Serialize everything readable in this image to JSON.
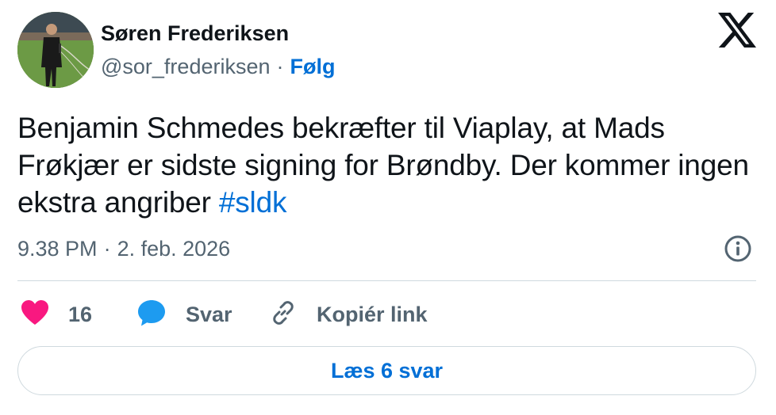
{
  "author": {
    "name": "Søren Frederiksen",
    "handle": "@sor_frederiksen",
    "separator": "·",
    "follow_label": "Følg"
  },
  "tweet": {
    "text": "Benjamin Schmedes bekræfter til Viaplay, at Mads Frøkjær er sidste signing for Brøndby. Der kommer ingen ekstra angriber ",
    "hashtag": "#sldk",
    "time": "9.38 PM",
    "time_separator": "·",
    "date": "2. feb. 2026"
  },
  "actions": {
    "like_count": "16",
    "reply_label": "Svar",
    "copy_link_label": "Kopiér link"
  },
  "read_replies_label": "Læs 6 svar",
  "icons": {
    "like": "heart-icon",
    "reply": "speech-bubble-icon",
    "copy": "link-icon",
    "info": "info-icon",
    "brand": "x-logo-icon"
  },
  "colors": {
    "text": "#0f1419",
    "secondary": "#536471",
    "link": "#006fd6",
    "like": "#f91880",
    "reply": "#1d9bf0",
    "border": "#cfd9de"
  }
}
